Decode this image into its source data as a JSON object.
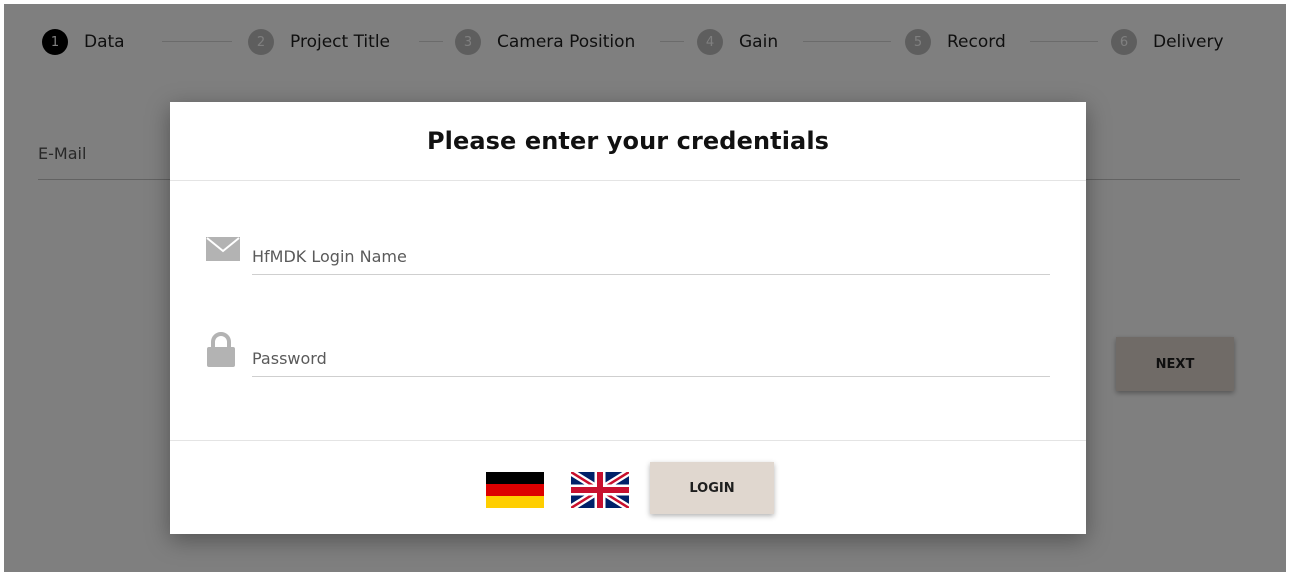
{
  "stepper": {
    "steps": [
      {
        "number": "1",
        "label": "Data"
      },
      {
        "number": "2",
        "label": "Project Title"
      },
      {
        "number": "3",
        "label": "Camera Position"
      },
      {
        "number": "4",
        "label": "Gain"
      },
      {
        "number": "5",
        "label": "Record"
      },
      {
        "number": "6",
        "label": "Delivery"
      }
    ],
    "active_step": 1
  },
  "form": {
    "email_label": "E-Mail",
    "next_label": "NEXT"
  },
  "modal": {
    "title": "Please enter your credentials",
    "login_field": {
      "placeholder": "HfMDK Login Name",
      "value": "",
      "icon": "envelope-icon"
    },
    "password_field": {
      "placeholder": "Password",
      "value": "",
      "icon": "lock-icon"
    },
    "languages": [
      "german-flag-icon",
      "uk-flag-icon"
    ],
    "login_label": "LOGIN"
  },
  "colors": {
    "accent_button": "#e0d7cf",
    "active_step": "#000000",
    "inactive_step": "#bdbdbd",
    "overlay": "rgba(0,0,0,0.5)"
  }
}
